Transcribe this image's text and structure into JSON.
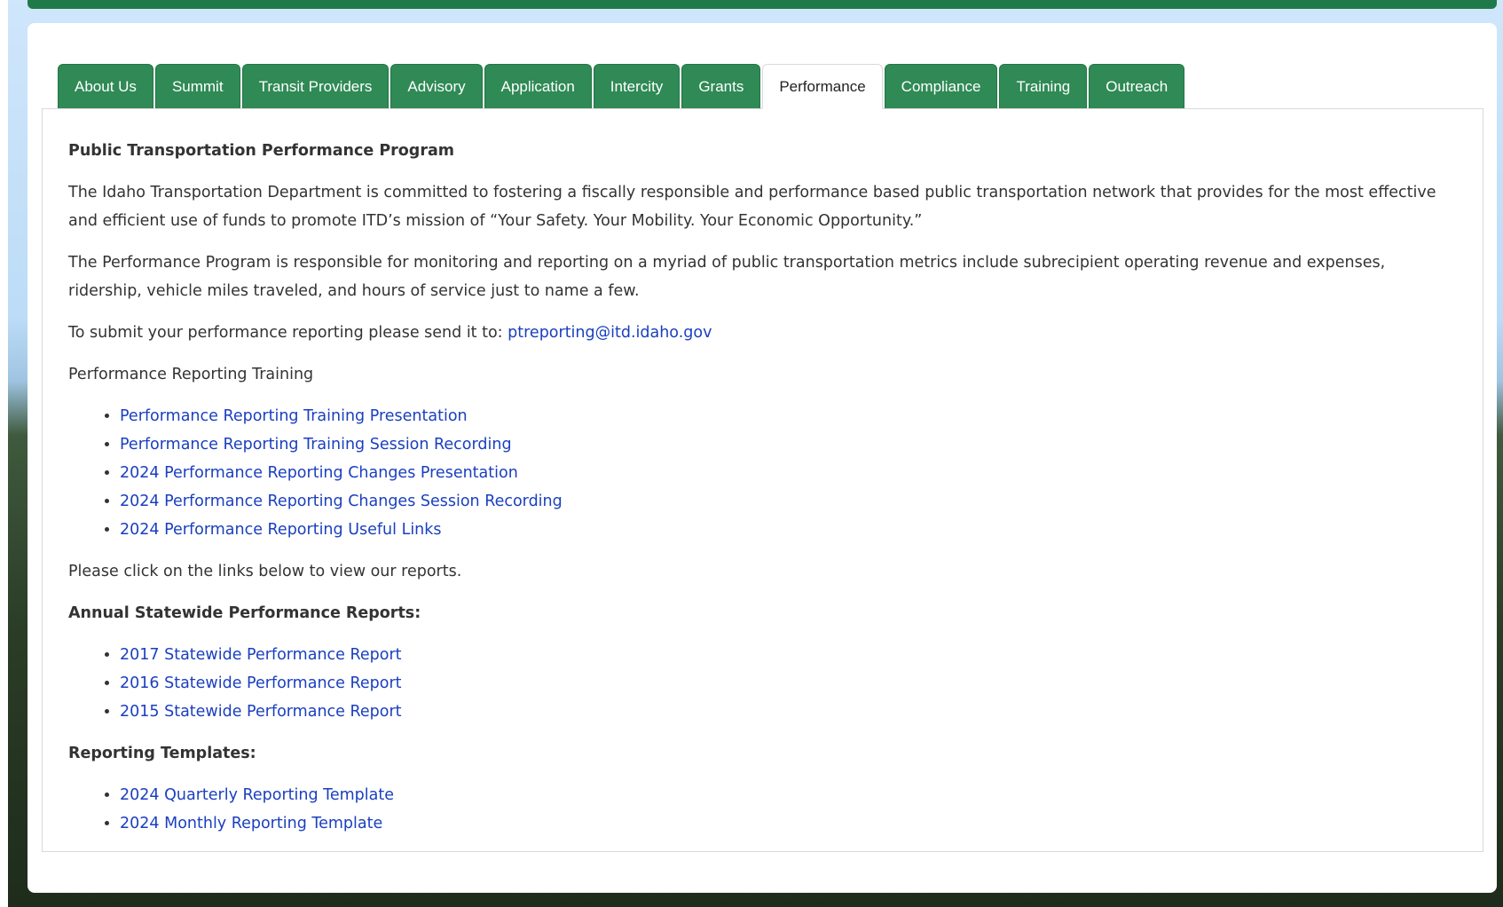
{
  "tabs": [
    {
      "label": "About Us",
      "active": false
    },
    {
      "label": "Summit",
      "active": false
    },
    {
      "label": "Transit Providers",
      "active": false
    },
    {
      "label": "Advisory",
      "active": false
    },
    {
      "label": "Application",
      "active": false
    },
    {
      "label": "Intercity",
      "active": false
    },
    {
      "label": "Grants",
      "active": false
    },
    {
      "label": "Performance",
      "active": true
    },
    {
      "label": "Compliance",
      "active": false
    },
    {
      "label": "Training",
      "active": false
    },
    {
      "label": "Outreach",
      "active": false
    }
  ],
  "content": {
    "heading": "Public Transportation Performance Program",
    "intro": "The Idaho Transportation Department is committed to fostering a fiscally responsible and performance based public transportation network that provides for the most effective and efficient use of funds to promote ITD’s mission of “Your Safety. Your Mobility. Your Economic Opportunity.”",
    "program": "The Performance Program is responsible for monitoring and reporting on a myriad of public transportation metrics include subrecipient operating revenue and expenses, ridership, vehicle miles traveled, and hours of service just to name a few.",
    "submit_text": "To submit your performance reporting please send it to: ",
    "submit_email": "ptreporting@itd.idaho.gov",
    "training_label": "Performance Reporting Training",
    "training_links": [
      "Performance Reporting Training Presentation",
      "Performance Reporting Training Session Recording",
      "2024 Performance Reporting Changes Presentation",
      "2024 Performance Reporting Changes Session Recording",
      "2024 Performance Reporting Useful Links"
    ],
    "reports_intro": "Please click on the links below to view our reports.",
    "annual_heading": "Annual Statewide Performance Reports:",
    "annual_links": [
      "2017 Statewide Performance Report",
      "2016 Statewide Performance Report",
      "2015 Statewide Performance Report"
    ],
    "templates_heading": "Reporting Templates:",
    "template_links": [
      "2024 Quarterly Reporting Template",
      "2024 Monthly Reporting Template"
    ]
  },
  "colors": {
    "tab_green": "#2f8a55",
    "link_blue": "#1a3fbf",
    "top_bar_green": "#1f7a4a"
  }
}
